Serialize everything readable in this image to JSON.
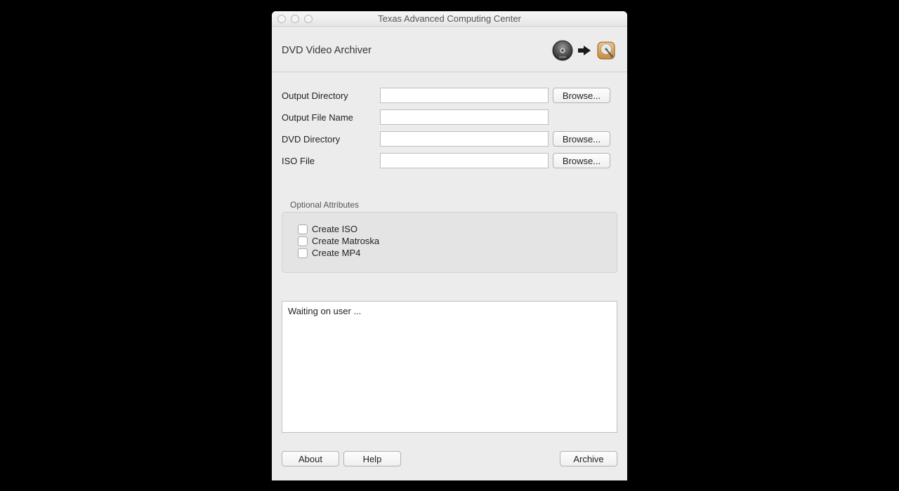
{
  "window": {
    "title": "Texas Advanced Computing Center"
  },
  "header": {
    "app_title": "DVD Video Archiver"
  },
  "form": {
    "output_directory": {
      "label": "Output Directory",
      "value": "",
      "browse": "Browse..."
    },
    "output_file_name": {
      "label": "Output File Name",
      "value": ""
    },
    "dvd_directory": {
      "label": "DVD Directory",
      "value": "",
      "browse": "Browse..."
    },
    "iso_file": {
      "label": "ISO File",
      "value": "",
      "browse": "Browse..."
    }
  },
  "optional": {
    "legend": "Optional Attributes",
    "create_iso": "Create ISO",
    "create_matroska": "Create Matroska",
    "create_mp4": "Create MP4"
  },
  "log": {
    "text": "Waiting on user ..."
  },
  "footer": {
    "about": "About",
    "help": "Help",
    "archive": "Archive"
  }
}
